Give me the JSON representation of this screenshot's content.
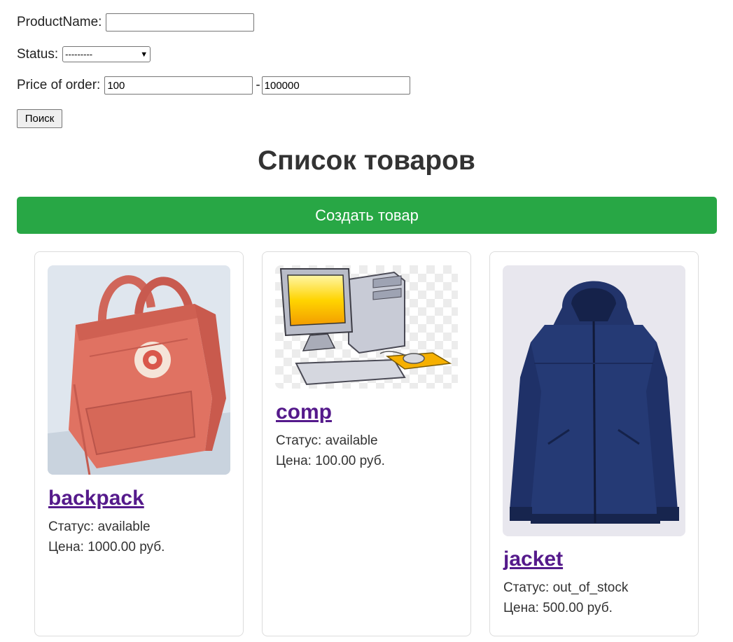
{
  "filters": {
    "product_name_label": "ProductName:",
    "product_name_value": "",
    "status_label": "Status:",
    "status_value": "---------",
    "price_label": "Price of order:",
    "price_min": "100",
    "price_separator": "-",
    "price_max": "100000",
    "search_button": "Поиск"
  },
  "page_title": "Список товаров",
  "create_button": "Создать товар",
  "colors": {
    "create_button_bg": "#28a745",
    "link": "#551a8b"
  },
  "products": [
    {
      "name": "backpack",
      "status": "Статус: available",
      "price": "Цена: 1000.00 руб.",
      "image": "backpack-image"
    },
    {
      "name": "comp",
      "status": "Статус: available",
      "price": "Цена: 100.00 руб.",
      "image": "computer-image"
    },
    {
      "name": "jacket",
      "status": "Статус: out_of_stock",
      "price": "Цена: 500.00 руб.",
      "image": "jacket-image"
    }
  ]
}
